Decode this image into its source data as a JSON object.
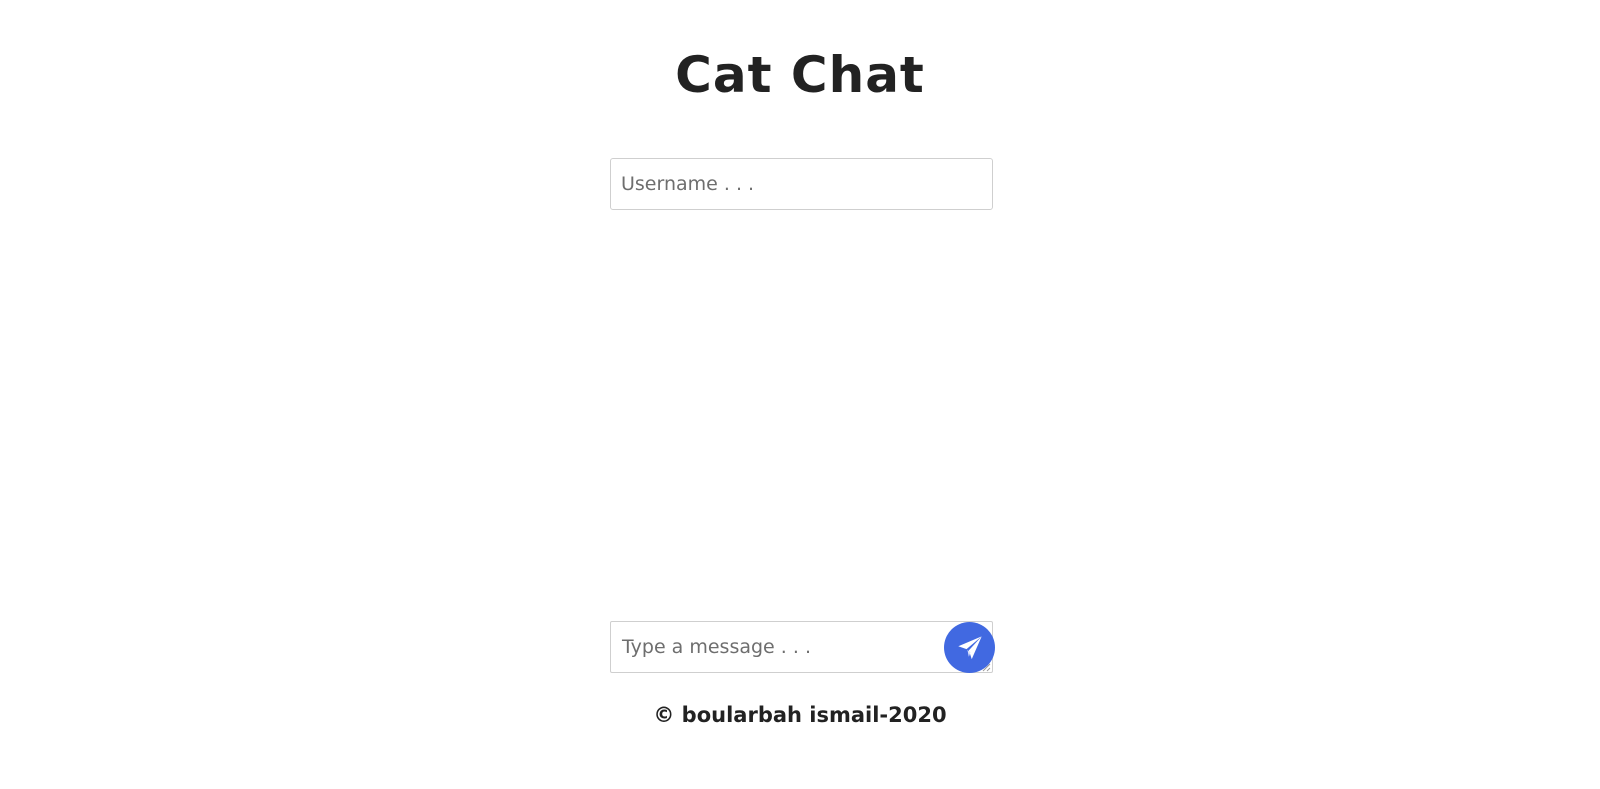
{
  "app": {
    "title": "Cat Chat"
  },
  "username_field": {
    "placeholder": "Username . . .",
    "value": ""
  },
  "message_field": {
    "placeholder": "Type a message . . .",
    "value": ""
  },
  "send_button": {
    "icon": "paper-plane-icon",
    "color": "#4169e1"
  },
  "footer": {
    "text": "© boularbah ismail-2020"
  }
}
